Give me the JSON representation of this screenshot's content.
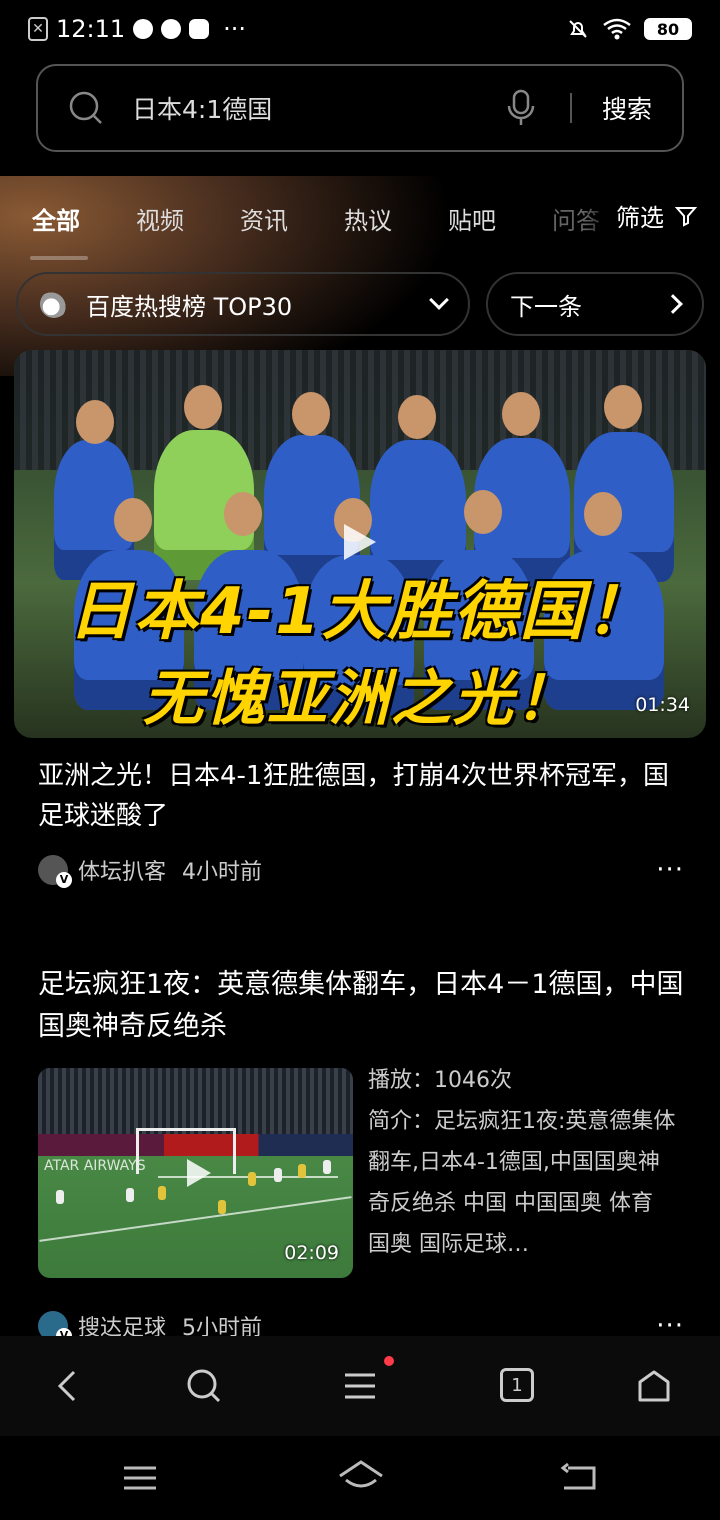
{
  "status_bar": {
    "time": "12:11",
    "more": "···",
    "battery": "80"
  },
  "search": {
    "query": "日本4:1德国",
    "button": "搜索"
  },
  "tabs": [
    {
      "label": "全部"
    },
    {
      "label": "视频"
    },
    {
      "label": "资讯"
    },
    {
      "label": "热议"
    },
    {
      "label": "贴吧"
    },
    {
      "label": "问答"
    }
  ],
  "filter_label": "筛选",
  "hot_list": {
    "label": "百度热搜榜 TOP30",
    "next": "下一条"
  },
  "result1": {
    "caption_line1": "日本4-1大胜德国！",
    "caption_line2": "无愧亚洲之光！",
    "duration": "01:34",
    "title": "亚洲之光！日本4-1狂胜德国，打崩4次世界杯冠军，国足球迷酸了",
    "source": "体坛扒客",
    "time": "4小时前",
    "more": "···"
  },
  "result2": {
    "title": "足坛疯狂1夜：英意德集体翻车，日本4－1德国，中国国奥神奇反绝杀",
    "duration": "02:09",
    "play_count": "播放：1046次",
    "intro": "简介：足坛疯狂1夜:英意德集体翻车,日本4-1德国,中国国奥神奇反绝杀 中国 中国国奥 体育 国奥 国际足球…",
    "adboard_text": "ATAR AIRWAYS",
    "source": "搜达足球",
    "time": "5小时前",
    "more": "···"
  },
  "toolbar": {
    "tab_count": "1"
  },
  "colors": {
    "background": "#000000",
    "caption": "#ffd400",
    "jersey": "#2f5fc6",
    "notification_dot": "#ff3b4a"
  }
}
